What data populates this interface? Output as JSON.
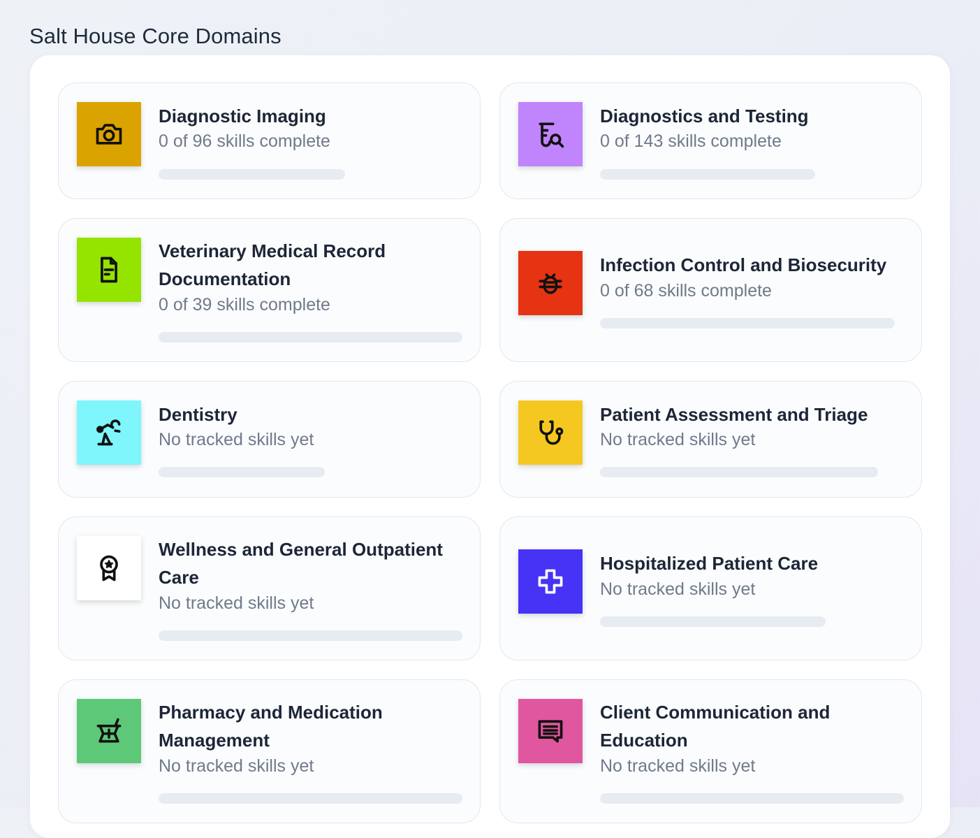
{
  "page": {
    "title": "Salt House Core Domains"
  },
  "domains": [
    {
      "title": "Diagnostic Imaging",
      "status": "0 of 96 skills complete",
      "progress": 0,
      "icon": "camera-icon",
      "color": "#dba300"
    },
    {
      "title": "Diagnostics and Testing",
      "status": "0 of 143 skills complete",
      "progress": 0,
      "icon": "test-tube-search-icon",
      "color": "#c084fc"
    },
    {
      "title": "Veterinary Medical Record Documentation",
      "status": "0 of 39 skills complete",
      "progress": 0,
      "icon": "document-icon",
      "color": "#94e400"
    },
    {
      "title": "Infection Control and Biosecurity",
      "status": "0 of 68 skills complete",
      "progress": 0,
      "icon": "bug-icon",
      "color": "#e63312"
    },
    {
      "title": "Dentistry",
      "status": "No tracked skills yet",
      "progress": 0,
      "icon": "dental-tool-icon",
      "color": "#7ef6fb"
    },
    {
      "title": "Patient Assessment and Triage",
      "status": "No tracked skills yet",
      "progress": 0,
      "icon": "stethoscope-icon",
      "color": "#f4c820"
    },
    {
      "title": "Wellness and General Outpatient Care",
      "status": "No tracked skills yet",
      "progress": 0,
      "icon": "award-ribbon-icon",
      "color": "#ffffff"
    },
    {
      "title": "Hospitalized Patient Care",
      "status": "No tracked skills yet",
      "progress": 0,
      "icon": "medical-cross-icon",
      "color": "#4633f5"
    },
    {
      "title": "Pharmacy and Medication Management",
      "status": "No tracked skills yet",
      "progress": 0,
      "icon": "mortar-pestle-icon",
      "color": "#5dc978"
    },
    {
      "title": "Client Communication and Education",
      "status": "No tracked skills yet",
      "progress": 0,
      "icon": "message-icon",
      "color": "#e0569f"
    }
  ]
}
